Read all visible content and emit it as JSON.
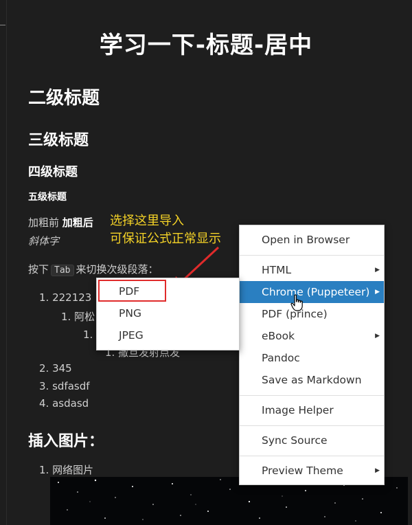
{
  "document": {
    "h1": "学习一下-标题-居中",
    "h2": "二级标题",
    "h3": "三级标题",
    "h4": "四级标题",
    "h5": "五级标题",
    "bold_before": "加粗前",
    "bold_after": "加粗后",
    "italic": "斜体字",
    "tab_prefix": "按下",
    "tab_key": "Tab",
    "tab_suffix": "来切换次级段落：",
    "list": [
      {
        "num": "1.",
        "text": "222123"
      },
      {
        "num": "1.",
        "text": "阿松"
      },
      {
        "num": "1.",
        "text": "一"
      },
      {
        "num": "1.",
        "text": "撒旦发射点发"
      },
      {
        "num": "2.",
        "text": "345"
      },
      {
        "num": "3.",
        "text": "sdfasdf"
      },
      {
        "num": "4.",
        "text": "asdasd"
      }
    ],
    "h_images": "插入图片：",
    "img_list": [
      {
        "num": "1.",
        "text": "网络图片"
      }
    ]
  },
  "annotation": {
    "line1": "选择这里导入",
    "line2": "可保证公式正常显示",
    "color": "#f5d327",
    "arrow_color": "#e02b2b"
  },
  "context_menu": {
    "open_in_browser": "Open in Browser",
    "html": "HTML",
    "chrome": "Chrome (Puppeteer)",
    "pdf_prince": "PDF (prince)",
    "ebook": "eBook",
    "pandoc": "Pandoc",
    "save_markdown": "Save as Markdown",
    "image_helper": "Image Helper",
    "sync_source": "Sync Source",
    "preview_theme": "Preview Theme",
    "highlight_color": "#2a7fc1"
  },
  "submenu": {
    "pdf": "PDF",
    "png": "PNG",
    "jpeg": "JPEG",
    "selected_outline": "#e02b2b"
  }
}
